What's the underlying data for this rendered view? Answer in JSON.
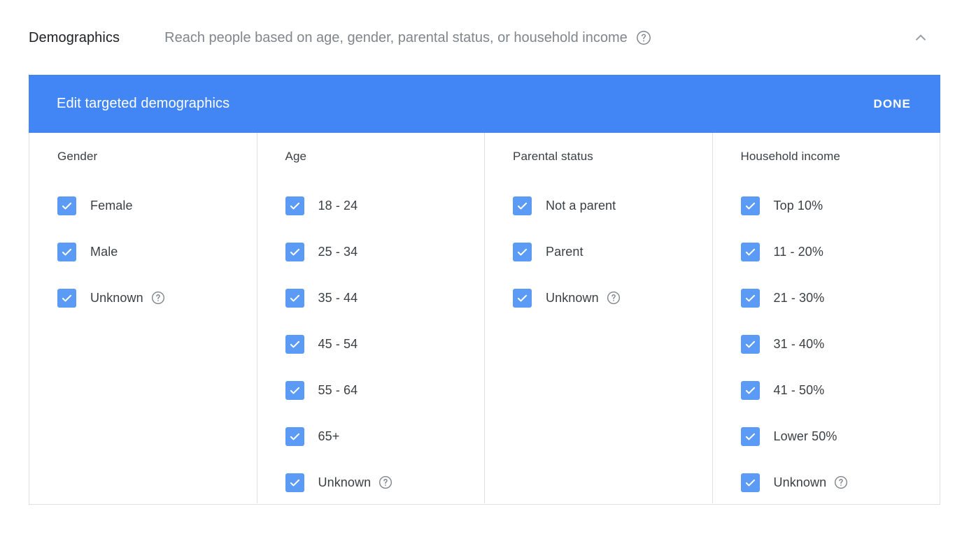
{
  "header": {
    "title": "Demographics",
    "description": "Reach people based on age, gender, parental status, or household income",
    "help_icon": "help-circle-icon",
    "collapse_icon": "chevron-up-icon"
  },
  "panel": {
    "bar_title": "Edit targeted demographics",
    "done_label": "DONE",
    "accent_color": "#4285f4",
    "checkbox_color": "#5b9af5",
    "columns": [
      {
        "title": "Gender",
        "options": [
          {
            "label": "Female",
            "checked": true,
            "help": false
          },
          {
            "label": "Male",
            "checked": true,
            "help": false
          },
          {
            "label": "Unknown",
            "checked": true,
            "help": true
          }
        ]
      },
      {
        "title": "Age",
        "options": [
          {
            "label": "18 - 24",
            "checked": true,
            "help": false
          },
          {
            "label": "25 - 34",
            "checked": true,
            "help": false
          },
          {
            "label": "35 - 44",
            "checked": true,
            "help": false
          },
          {
            "label": "45 - 54",
            "checked": true,
            "help": false
          },
          {
            "label": "55 - 64",
            "checked": true,
            "help": false
          },
          {
            "label": "65+",
            "checked": true,
            "help": false
          },
          {
            "label": "Unknown",
            "checked": true,
            "help": true
          }
        ]
      },
      {
        "title": "Parental status",
        "options": [
          {
            "label": "Not a parent",
            "checked": true,
            "help": false
          },
          {
            "label": "Parent",
            "checked": true,
            "help": false
          },
          {
            "label": "Unknown",
            "checked": true,
            "help": true
          }
        ]
      },
      {
        "title": "Household income",
        "options": [
          {
            "label": "Top 10%",
            "checked": true,
            "help": false
          },
          {
            "label": "11 - 20%",
            "checked": true,
            "help": false
          },
          {
            "label": "21 - 30%",
            "checked": true,
            "help": false
          },
          {
            "label": "31 - 40%",
            "checked": true,
            "help": false
          },
          {
            "label": "41 - 50%",
            "checked": true,
            "help": false
          },
          {
            "label": "Lower 50%",
            "checked": true,
            "help": false
          },
          {
            "label": "Unknown",
            "checked": true,
            "help": true
          }
        ]
      }
    ]
  }
}
